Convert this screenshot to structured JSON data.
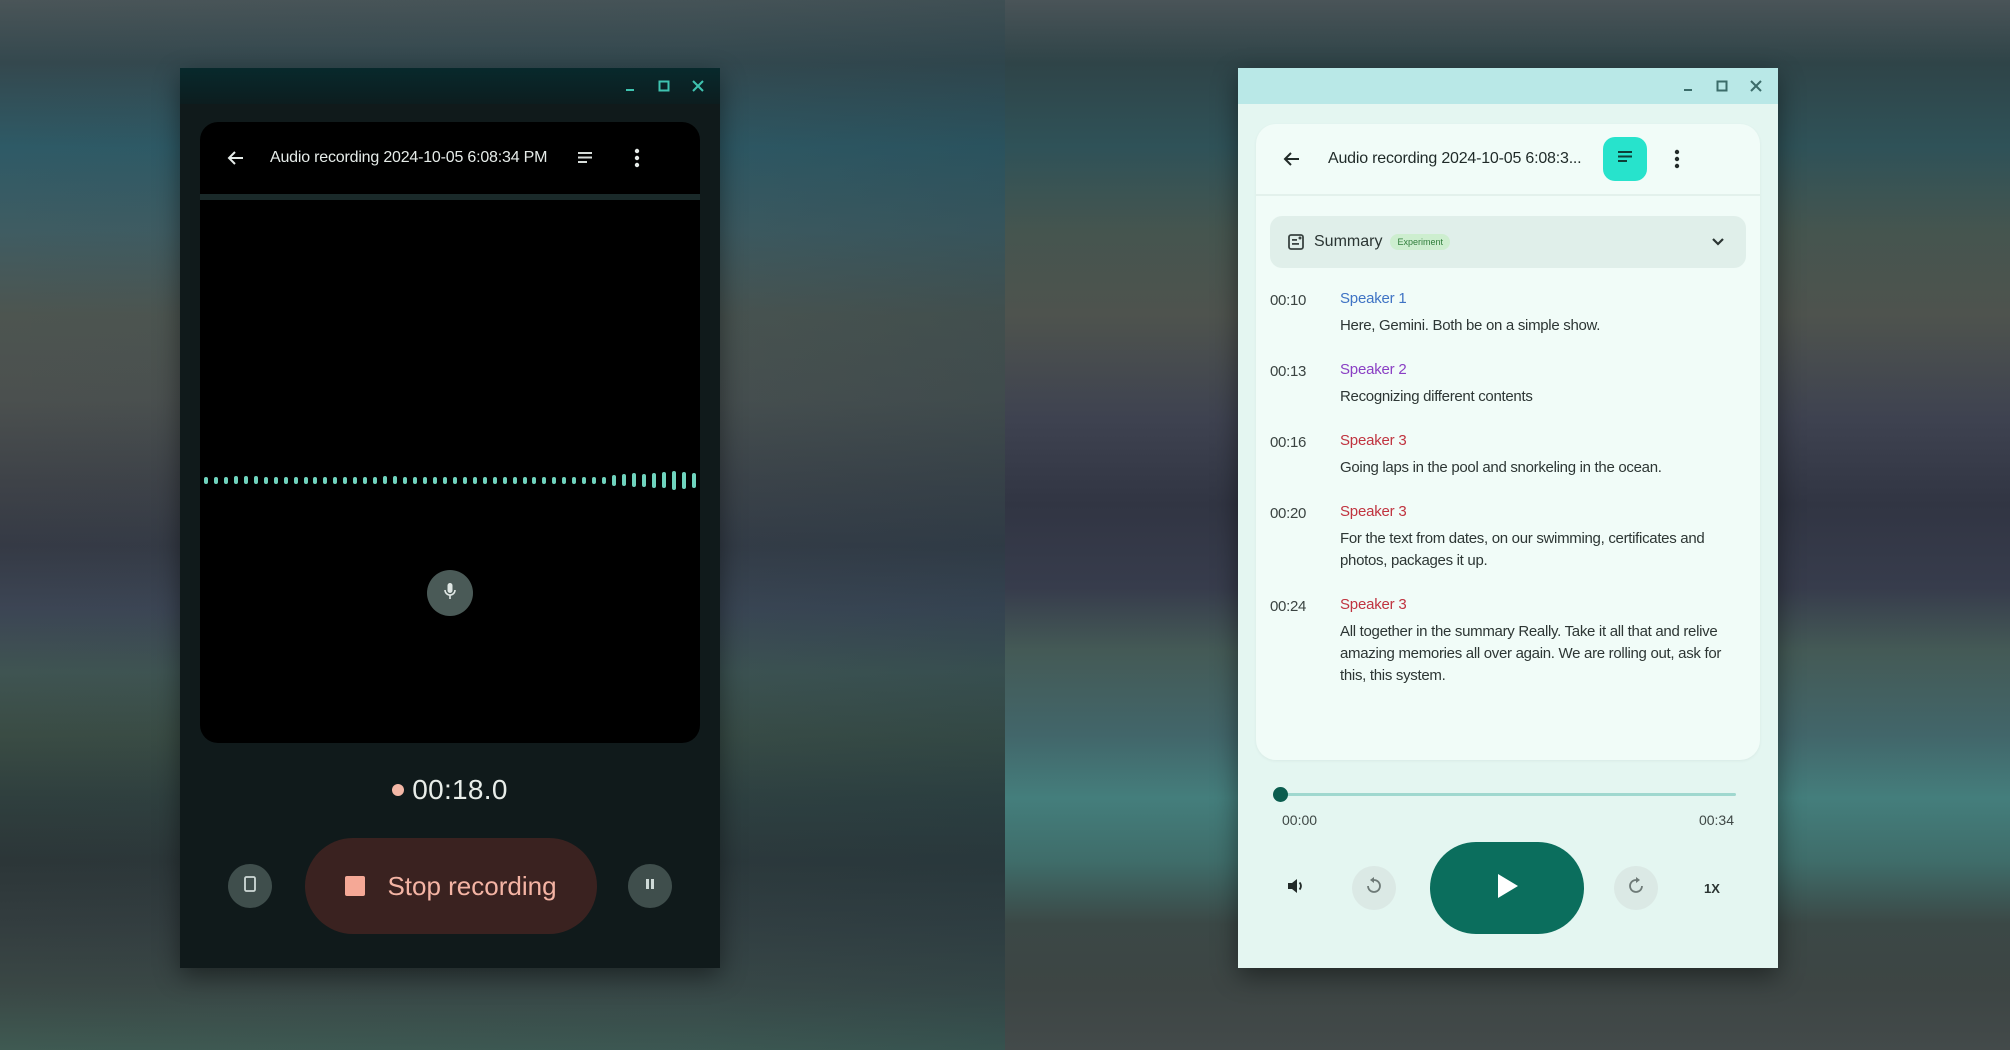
{
  "left_window": {
    "title": "Audio recording 2024-10-05 6:08:34 PM",
    "icons": {
      "minimize": "minimize-icon",
      "maximize": "maximize-icon",
      "close": "close-icon",
      "back": "arrow-back-icon",
      "transcript": "transcript-icon",
      "more": "more-vert-icon",
      "mic": "mic-icon",
      "delete": "delete-icon",
      "stop": "stop-icon",
      "pause": "pause-icon"
    },
    "waveform_levels": [
      0.35,
      0.35,
      0.35,
      0.4,
      0.4,
      0.4,
      0.35,
      0.35,
      0.35,
      0.35,
      0.35,
      0.35,
      0.35,
      0.35,
      0.35,
      0.35,
      0.35,
      0.35,
      0.4,
      0.4,
      0.35,
      0.35,
      0.35,
      0.35,
      0.35,
      0.35,
      0.35,
      0.35,
      0.35,
      0.35,
      0.35,
      0.35,
      0.35,
      0.35,
      0.35,
      0.35,
      0.35,
      0.35,
      0.35,
      0.35,
      0.35,
      0.55,
      0.6,
      0.7,
      0.65,
      0.75,
      0.8,
      0.95,
      0.85,
      0.75
    ],
    "timer": "00:18.0",
    "stop_label": "Stop recording",
    "colors": {
      "accent": "#6fd3bd",
      "recording_dot": "#f3b7a6",
      "stop_bg": "#3a2220",
      "stop_text": "#f4b4a4"
    }
  },
  "right_window": {
    "title": "Audio recording 2024-10-05 6:08:3...",
    "icons": {
      "minimize": "minimize-icon",
      "maximize": "maximize-icon",
      "close": "close-icon",
      "back": "arrow-back-icon",
      "transcript": "transcript-icon",
      "more": "more-vert-icon",
      "summary": "summary-icon",
      "chevron": "chevron-down-icon",
      "volume": "volume-icon",
      "rewind": "replay-icon",
      "forward": "forward-icon",
      "play": "play-icon"
    },
    "summary": {
      "label": "Summary",
      "badge": "Experiment"
    },
    "transcript": [
      {
        "time": "00:10",
        "speaker": "Speaker 1",
        "color": "#3f73c4",
        "text": "Here, Gemini. Both be on a simple show."
      },
      {
        "time": "00:13",
        "speaker": "Speaker 2",
        "color": "#8a3fc4",
        "text": "Recognizing different contents"
      },
      {
        "time": "00:16",
        "speaker": "Speaker 3",
        "color": "#c0333f",
        "text": "Going laps in the pool and snorkeling in the ocean."
      },
      {
        "time": "00:20",
        "speaker": "Speaker 3",
        "color": "#c0333f",
        "text": "For the text from dates, on our swimming, certificates and photos, packages it up."
      },
      {
        "time": "00:24",
        "speaker": "Speaker 3",
        "color": "#c0333f",
        "text": "All together in the summary Really. Take it all that and relive amazing memories all over again. We are rolling out, ask for this, this system."
      }
    ],
    "playback": {
      "current": "00:00",
      "duration": "00:34",
      "progress_fraction": 0.0,
      "speed": "1X"
    },
    "colors": {
      "accent": "#0b6e5d",
      "transcript_btn": "#27e3cc"
    }
  }
}
